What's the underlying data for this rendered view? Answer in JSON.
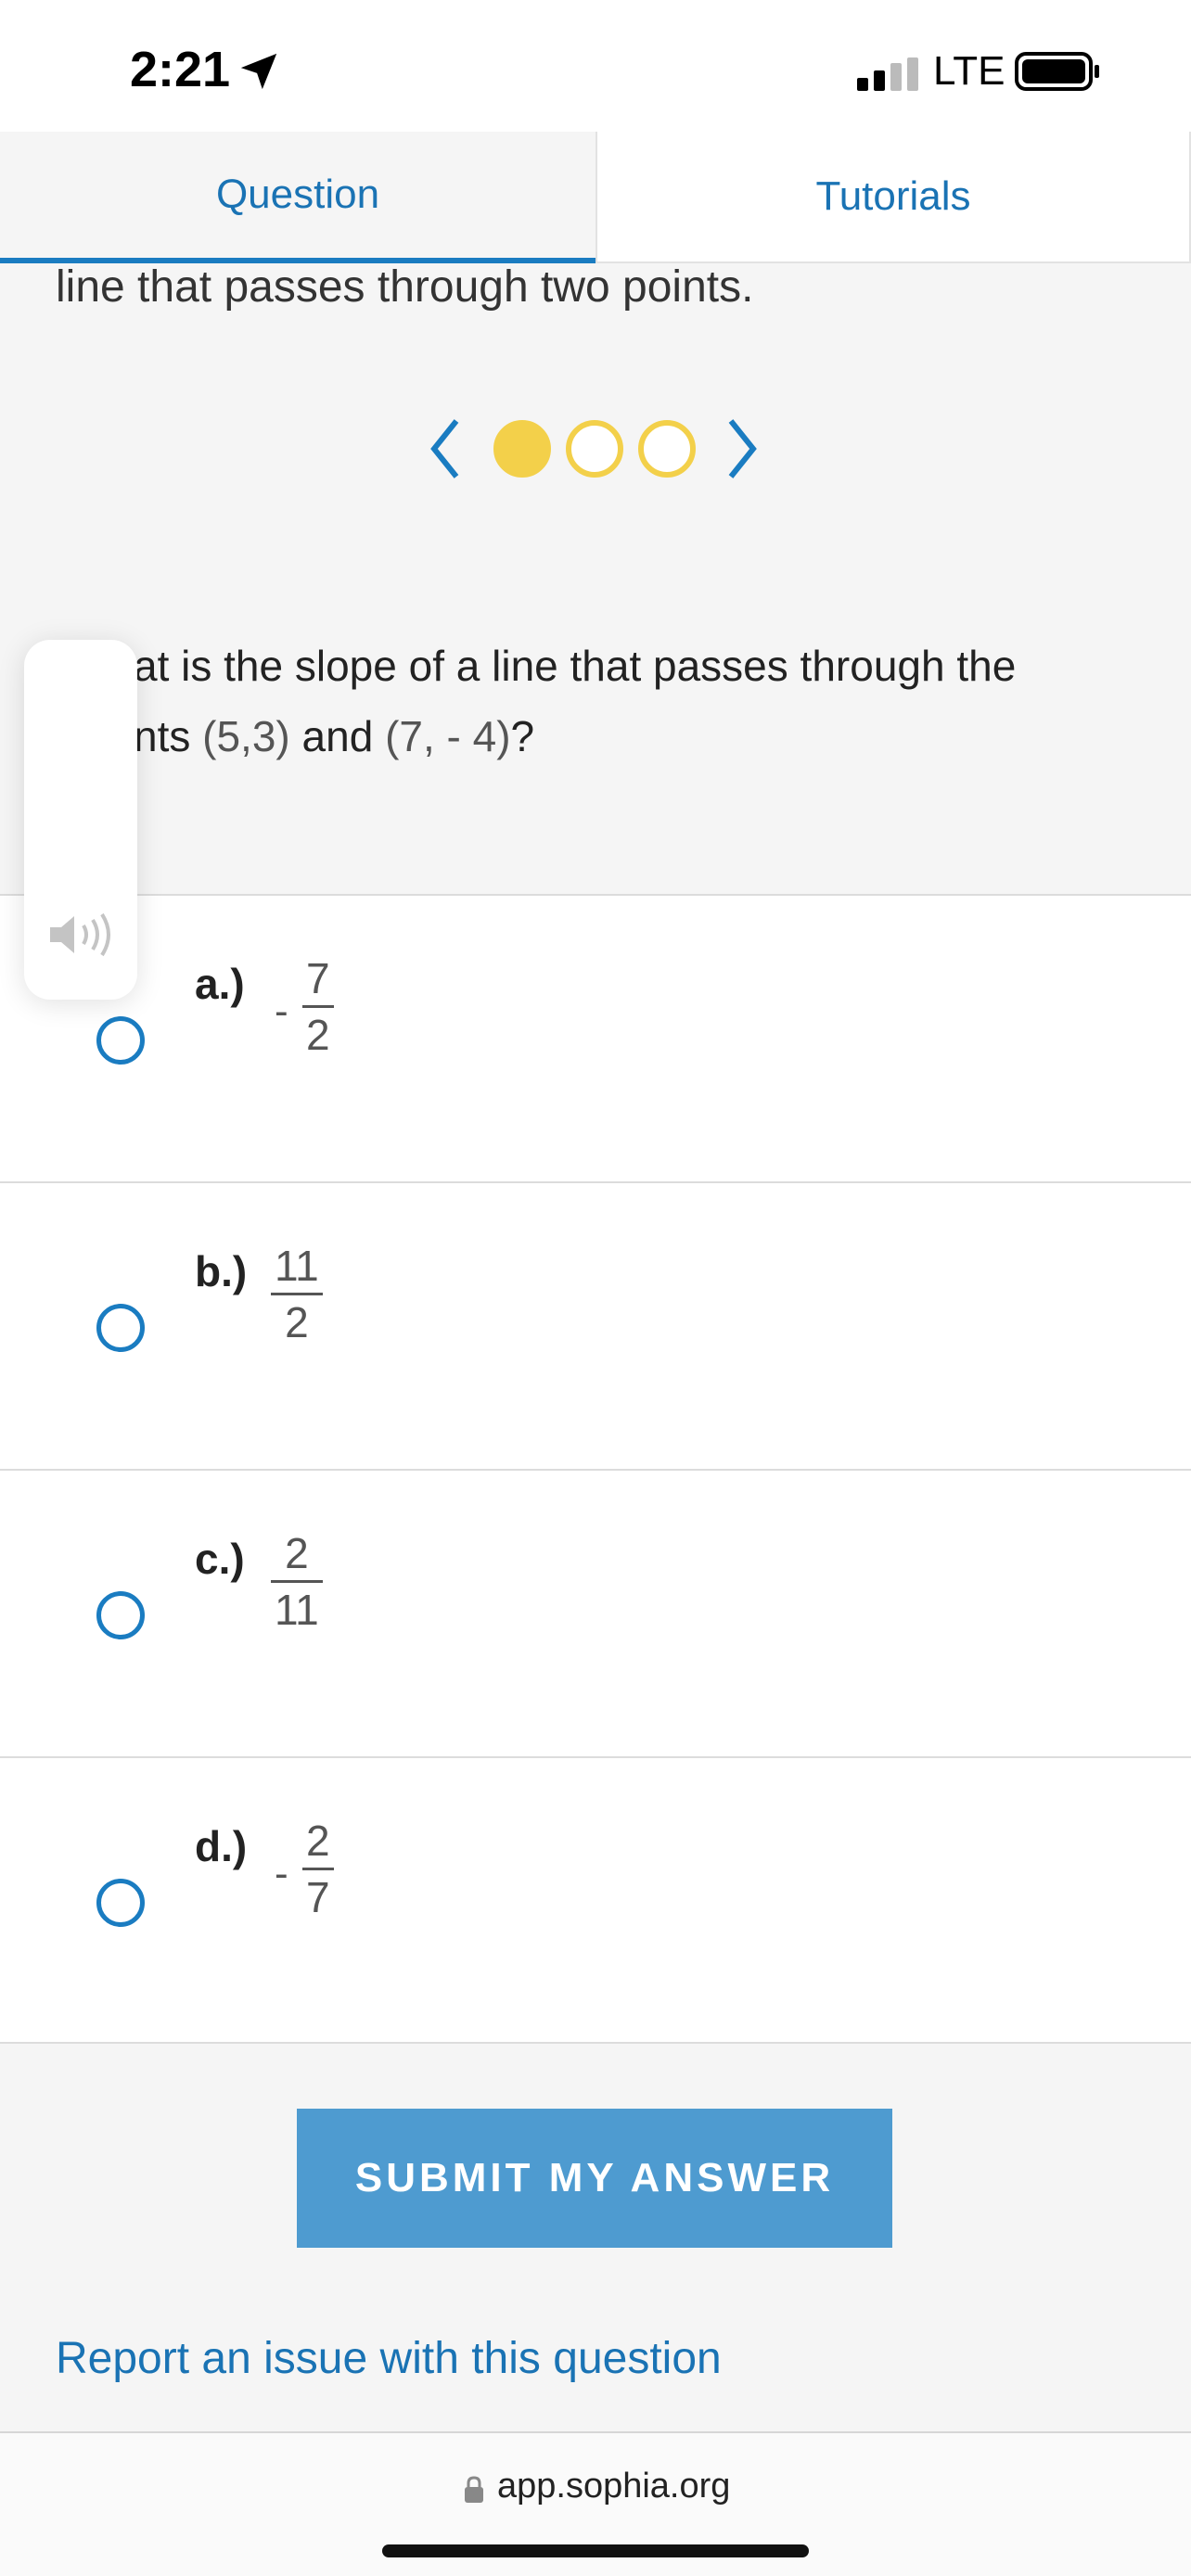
{
  "status_bar": {
    "time": "2:21",
    "network": "LTE"
  },
  "tabs": [
    {
      "label": "Question"
    },
    {
      "label": "Tutorials"
    }
  ],
  "intro_text": "line that passes through two points.",
  "carousel": {
    "pages": 3,
    "current": 1,
    "accent_color": "#f3d04a"
  },
  "question": {
    "line1": "at is the slope of a line that passes through the",
    "line2_prefix": "nts ",
    "point1": "(5,3)",
    "line2_mid": " and ",
    "point2": "(7, - 4)",
    "line2_suffix": "?"
  },
  "options": [
    {
      "label": "a.)",
      "sign": "-",
      "numerator": "7",
      "denominator": "2"
    },
    {
      "label": "b.)",
      "sign": "",
      "numerator": "11",
      "denominator": "2"
    },
    {
      "label": "c.)",
      "sign": "",
      "numerator": "2",
      "denominator": "11"
    },
    {
      "label": "d.)",
      "sign": "-",
      "numerator": "2",
      "denominator": "7"
    }
  ],
  "submit_label": "SUBMIT MY ANSWER",
  "report_link": "Report an issue with this question",
  "browser": {
    "url": "app.sophia.org"
  },
  "colors": {
    "primary": "#1a7cc1",
    "button": "#4e9bd0",
    "dot": "#f3d04a"
  }
}
